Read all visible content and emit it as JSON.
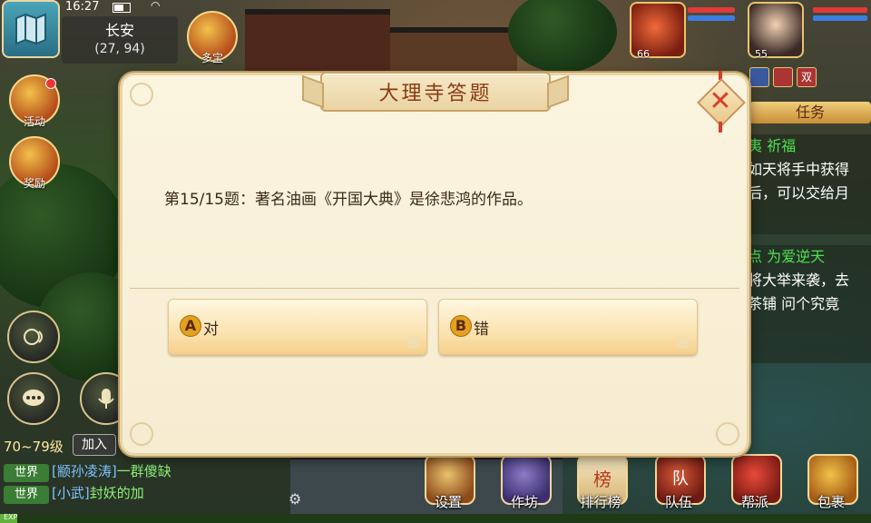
{
  "status": {
    "time": "16:27"
  },
  "location": {
    "name": "长安",
    "coords": "(27, 94)"
  },
  "left_buttons": {
    "activity": "活动",
    "reward": "奖励"
  },
  "top_buttons": {
    "treasure": "多宝"
  },
  "chat": {
    "level_range": "70~79级",
    "join_label": "加入",
    "lines": [
      {
        "channel": "世界",
        "sender": "[颛孙凌涛]",
        "text": "一群傻缺"
      },
      {
        "channel": "世界",
        "sender": "[小武]",
        "text": "封妖的加"
      }
    ],
    "exp_label": "EXP",
    "exp_progress": 0.02
  },
  "party": {
    "pet_level": "66",
    "player_level": "55",
    "icons": [
      "",
      "",
      "双"
    ]
  },
  "quest": {
    "title": "任务",
    "items": [
      {
        "head": "夷 祈福",
        "lines": [
          "如天将手中获得",
          "后，可以交给月"
        ]
      },
      {
        "head": "点 为爱逆天",
        "lines": [
          "将大举来袭，去",
          "茶铺 问个究竟"
        ]
      }
    ]
  },
  "bottom_menu": {
    "settings": "设置",
    "workshop": "作坊",
    "ranking": "排行榜",
    "ranking_icon": "榜",
    "team": "队伍",
    "team_icon": "队",
    "guild": "帮派",
    "bag": "包裹"
  },
  "dialog": {
    "title": "大理寺答题",
    "question": "第15/15题：著名油画《开国大典》是徐悲鸿的作品。",
    "answers": [
      {
        "letter": "A",
        "text": "对"
      },
      {
        "letter": "B",
        "text": "错"
      }
    ],
    "close_glyph": "✕"
  },
  "colors": {
    "dialog_bg": "#fbf4df",
    "title_text": "#8a3b14",
    "answer_letter_bg": "#e3a11f",
    "close_x": "#d6402a",
    "chat_channel": "#3a7d35",
    "chat_sender": "#7ec4ff",
    "chat_text": "#8ef07a"
  },
  "icons": [
    "map-icon",
    "battery-icon",
    "wifi-icon",
    "activity-icon",
    "reward-icon",
    "treasure-icon",
    "voice-icon",
    "chat-bubble-icon",
    "mic-icon",
    "gear-icon",
    "close-icon"
  ]
}
